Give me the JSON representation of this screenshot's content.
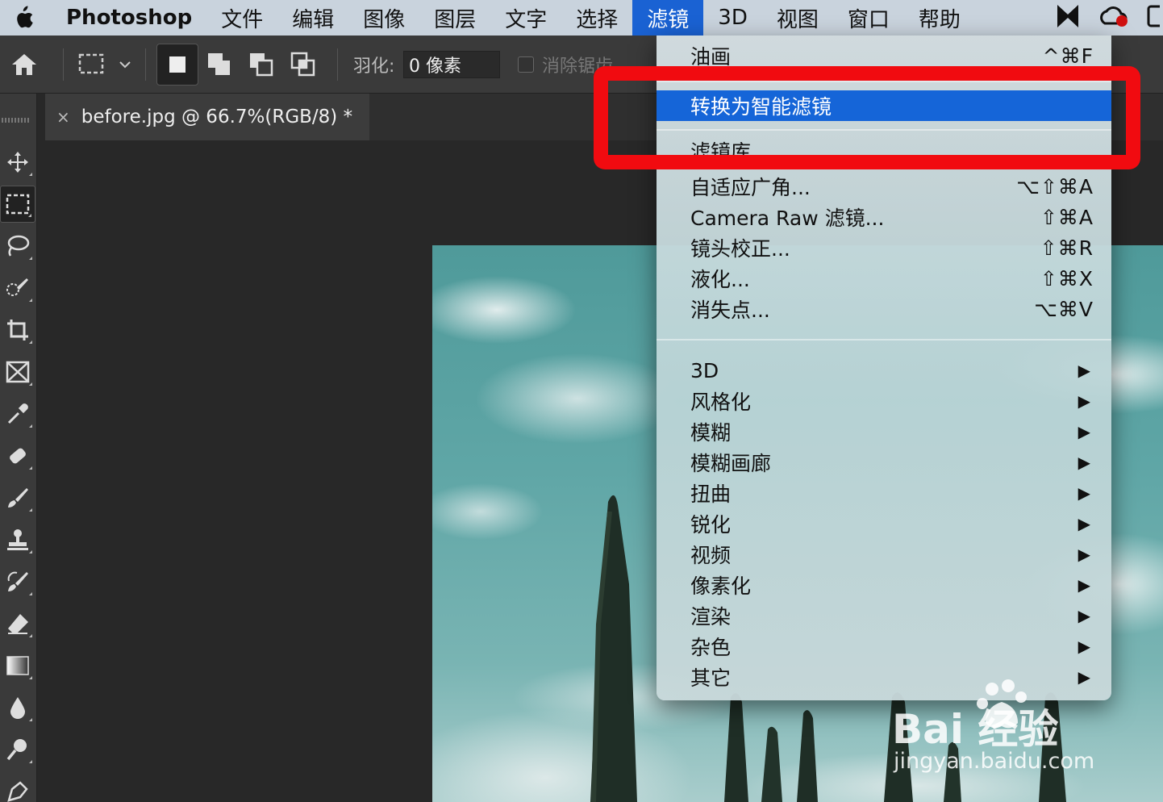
{
  "menubar": {
    "app_name": "Photoshop",
    "items": [
      "文件",
      "编辑",
      "图像",
      "图层",
      "文字",
      "选择",
      "滤镜",
      "3D",
      "视图",
      "窗口",
      "帮助"
    ],
    "active_item": "滤镜"
  },
  "optionsbar": {
    "feather_label": "羽化:",
    "feather_value": "0 像素",
    "antialias_label": "消除锯齿"
  },
  "document": {
    "tab_close": "×",
    "tab_title": "before.jpg @ 66.7%(RGB/8) *"
  },
  "filter_menu": {
    "last_filter": {
      "label": "油画",
      "shortcut": "^⌘F"
    },
    "convert_smart": {
      "label": "转换为智能滤镜"
    },
    "gallery": {
      "label": "滤镜库..."
    },
    "adaptive_wide": {
      "label": "自适应广角...",
      "shortcut": "⌥⇧⌘A"
    },
    "camera_raw": {
      "label": "Camera Raw 滤镜...",
      "shortcut": "⇧⌘A"
    },
    "lens_correction": {
      "label": "镜头校正...",
      "shortcut": "⇧⌘R"
    },
    "liquify": {
      "label": "液化...",
      "shortcut": "⇧⌘X"
    },
    "vanishing_point": {
      "label": "消失点...",
      "shortcut": "⌥⌘V"
    },
    "submenus": [
      "3D",
      "风格化",
      "模糊",
      "模糊画廊",
      "扭曲",
      "锐化",
      "视频",
      "像素化",
      "渲染",
      "杂色",
      "其它"
    ],
    "submenu_arrow": "▶"
  },
  "watermark": {
    "logo": "Bai  经验",
    "url": "jingyan.baidu.com"
  },
  "colors": {
    "menu_highlight": "#1565d8",
    "annotation_red": "#f10b10"
  }
}
